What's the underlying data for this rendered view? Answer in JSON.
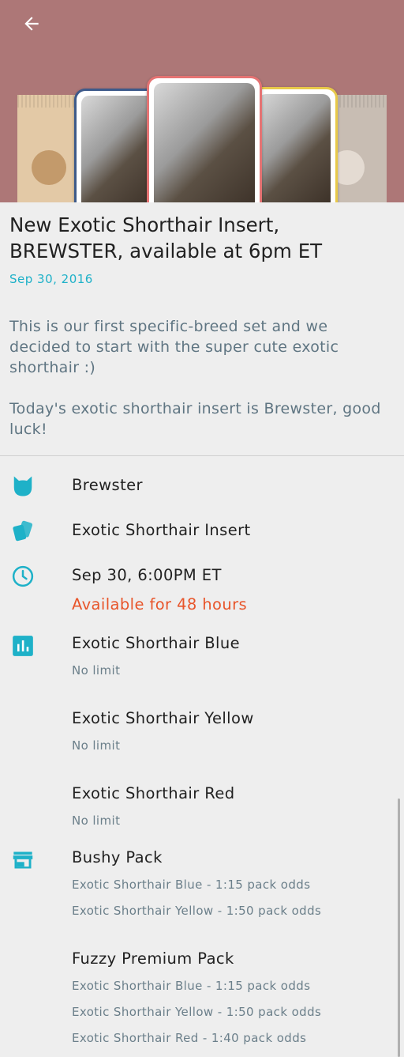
{
  "header": {
    "back_icon": "arrow-left-icon",
    "colors": {
      "background": "#ad7777",
      "card_blue": "#3d5a8a",
      "card_red": "#e57373",
      "card_yellow": "#e8c94a"
    }
  },
  "article": {
    "title": "New Exotic Shorthair Insert, BREWSTER, available at 6pm ET",
    "date": "Sep 30, 2016",
    "paragraphs": [
      "This is our first specific-breed set and we decided to start with the super cute exotic shorthair :)",
      "Today's exotic shorthair insert is Brewster, good luck!"
    ]
  },
  "details": {
    "name": {
      "icon": "cat-icon",
      "label": "Brewster"
    },
    "set": {
      "icon": "cards-icon",
      "label": "Exotic Shorthair Insert"
    },
    "time": {
      "icon": "clock-icon",
      "label": "Sep 30, 6:00PM ET",
      "availability": "Available for 48 hours"
    },
    "variants": {
      "icon": "bar-chart-icon",
      "items": [
        {
          "name": "Exotic Shorthair Blue",
          "limit": "No limit"
        },
        {
          "name": "Exotic Shorthair Yellow",
          "limit": "No limit"
        },
        {
          "name": "Exotic Shorthair Red",
          "limit": "No limit"
        }
      ]
    },
    "packs": {
      "icon": "store-icon",
      "items": [
        {
          "name": "Bushy Pack",
          "odds": [
            "Exotic Shorthair Blue - 1:15 pack odds",
            "Exotic Shorthair Yellow - 1:50 pack odds"
          ]
        },
        {
          "name": "Fuzzy Premium Pack",
          "odds": [
            "Exotic Shorthair Blue - 1:15 pack odds",
            "Exotic Shorthair Yellow - 1:50 pack odds",
            "Exotic Shorthair Red - 1:40 pack odds"
          ]
        }
      ]
    }
  },
  "colors": {
    "accent": "#1eb1c8",
    "availability": "#e8552a",
    "text": "#212121",
    "secondary_text": "#5f7582"
  }
}
